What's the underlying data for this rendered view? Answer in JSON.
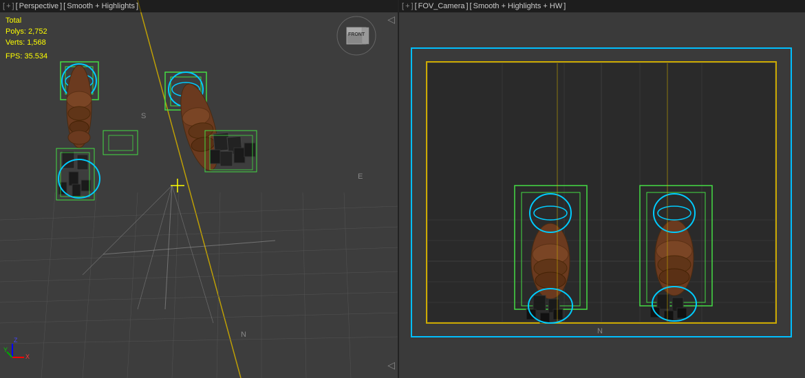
{
  "left_viewport": {
    "header": "[ + ] [ Perspective ] [ Smooth + Highlights ]",
    "plus": "+",
    "perspective_label": "Perspective",
    "shading_label": "Smooth + Highlights",
    "stats": {
      "total_label": "Total",
      "polys_label": "Polys:",
      "polys_value": "2,752",
      "verts_label": "Verts:",
      "verts_value": "1,568",
      "fps_label": "FPS:",
      "fps_value": "35.534"
    },
    "compass": {
      "n": "N",
      "s": "S",
      "e": "E"
    }
  },
  "right_viewport": {
    "header": "[ + ] [ FOV_Camera ] [ Smooth + Highlights + HW ]",
    "plus": "+",
    "camera_label": "FOV_Camera",
    "shading_label": "Smooth + Highlights + HW",
    "compass": {
      "n": "N"
    }
  },
  "icons": {
    "arrow_right": "◁",
    "nav_cube_label": "FRONT"
  }
}
